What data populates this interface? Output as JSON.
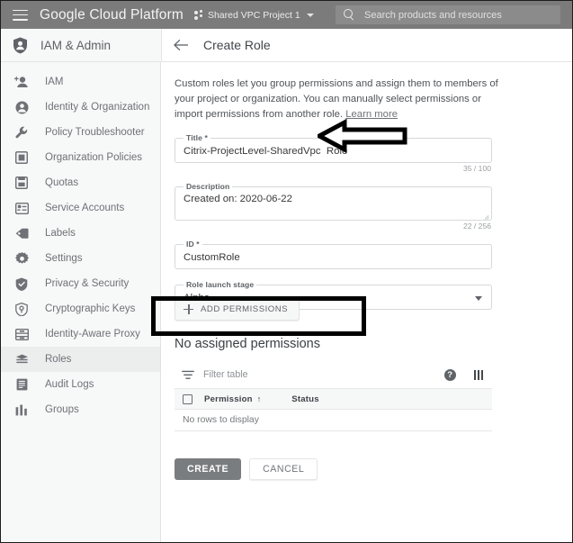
{
  "topbar": {
    "menu_icon": "hamburger-icon",
    "brand": "Google Cloud Platform",
    "project": "Shared VPC Project 1",
    "project_caret": "chevron-down-icon",
    "search_icon": "search-icon",
    "search_placeholder": "Search products and resources",
    "search_value": "",
    "bg_color": "#7b7b7b"
  },
  "subheader": {
    "product_icon": "shield-person-icon",
    "product": "IAM & Admin",
    "back_icon": "arrow-left-icon",
    "page_title": "Create Role"
  },
  "sidebar": {
    "items": [
      {
        "label": "IAM",
        "icon": "person-add-icon",
        "active": false
      },
      {
        "label": "Identity & Organization",
        "icon": "account-circle-icon",
        "active": false
      },
      {
        "label": "Policy Troubleshooter",
        "icon": "wrench-icon",
        "active": false
      },
      {
        "label": "Organization Policies",
        "icon": "organization-icon",
        "active": false
      },
      {
        "label": "Quotas",
        "icon": "quota-gauge-icon",
        "active": false
      },
      {
        "label": "Service Accounts",
        "icon": "service-account-icon",
        "active": false
      },
      {
        "label": "Labels",
        "icon": "label-tag-icon",
        "active": false
      },
      {
        "label": "Settings",
        "icon": "gear-icon",
        "active": false
      },
      {
        "label": "Privacy & Security",
        "icon": "shield-check-icon",
        "active": false
      },
      {
        "label": "Cryptographic Keys",
        "icon": "key-shield-icon",
        "active": false
      },
      {
        "label": "Identity-Aware Proxy",
        "icon": "iap-grid-icon",
        "active": false
      },
      {
        "label": "Roles",
        "icon": "roles-stack-icon",
        "active": true
      },
      {
        "label": "Audit Logs",
        "icon": "list-lines-icon",
        "active": false
      },
      {
        "label": "Groups",
        "icon": "groups-icon",
        "active": false
      }
    ]
  },
  "main": {
    "blurb": "Custom roles let you group permissions and assign them to members of your project or organization. You can manually select permissions or import permissions from another role.",
    "blurb_link": "Learn more",
    "fields": {
      "title": {
        "label": "Title *",
        "value": "Citrix-ProjectLevel-SharedVpc  Role",
        "counter": "35 / 100"
      },
      "description": {
        "label": "Description",
        "value": "Created on: 2020-06-22",
        "counter": "22 / 256"
      },
      "id": {
        "label": "ID *",
        "value": "CustomRole"
      },
      "launch_stage": {
        "label": "Role launch stage",
        "value": "Alpha",
        "caret_icon": "chevron-down-icon"
      }
    },
    "add_permissions": {
      "label": "ADD PERMISSIONS",
      "icon": "plus-icon"
    },
    "section_heading": "No assigned permissions",
    "table": {
      "filter_icon": "filter-icon",
      "filter_placeholder": "Filter table",
      "help_icon": "help-icon",
      "help_glyph": "?",
      "columns_icon": "column-settings-icon",
      "select_all_icon": "checkbox-icon",
      "headers": [
        "Permission",
        "Status"
      ],
      "sort_icon": "arrow-up-icon",
      "sort_glyph": "↑",
      "empty_text": "No rows to display",
      "rows": []
    },
    "buttons": {
      "create": "CREATE",
      "cancel": "CANCEL"
    }
  },
  "annotations": {
    "arrow": {
      "icon": "left-arrow-annotation",
      "color": "#000000"
    },
    "rectangle": {
      "icon": "highlight-rectangle-annotation",
      "color": "#000000"
    }
  }
}
